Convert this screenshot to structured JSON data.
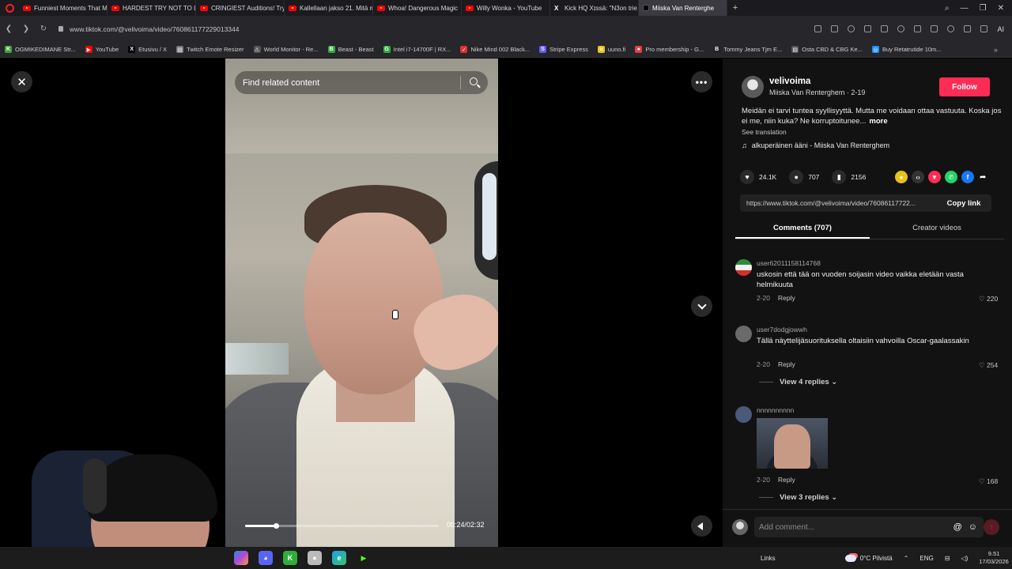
{
  "browser": {
    "tabs": [
      {
        "label": "Funniest Moments That M",
        "icon": "youtube-icon"
      },
      {
        "label": "HARDEST TRY NOT TO LAI",
        "icon": "youtube-icon"
      },
      {
        "label": "CRINGIEST Auditions! Try",
        "icon": "youtube-icon"
      },
      {
        "label": "Kallellaan jakso 21. Mitä m",
        "icon": "youtube-icon"
      },
      {
        "label": "Whoa! Dangerous Magic",
        "icon": "youtube-icon"
      },
      {
        "label": "Willy Wonka - YouTube",
        "icon": "youtube-icon"
      },
      {
        "label": "Kick HQ Xɪssä: \"N3on trie",
        "icon": "x-icon"
      },
      {
        "label": "Miiska Van Renterghe",
        "icon": "tiktok-icon",
        "active": true
      }
    ],
    "url": "www.tiktok.com/@velivoima/video/760861177229013344",
    "ai_label": "AI",
    "bookmarks": [
      {
        "label": "OGMIKEDIMANE Str...",
        "color": "#3fa535",
        "glyph": "K"
      },
      {
        "label": "YouTube",
        "color": "#ff0000",
        "glyph": "▶"
      },
      {
        "label": "Etusivu / X",
        "color": "#000000",
        "glyph": "X"
      },
      {
        "label": "Twitch Emote Resizer",
        "color": "#777777",
        "glyph": "▤"
      },
      {
        "label": "World Monitor - Re...",
        "color": "#555555",
        "glyph": "⚠"
      },
      {
        "label": "Beast - Beast",
        "color": "#2fae3a",
        "glyph": "B"
      },
      {
        "label": "Intel i7-14700F | RX...",
        "color": "#2fae3a",
        "glyph": "G"
      },
      {
        "label": "Nike Mind 002 Black...",
        "color": "#e03030",
        "glyph": "✓"
      },
      {
        "label": "Stripe Express",
        "color": "#635bff",
        "glyph": "S"
      },
      {
        "label": "uuno.fi",
        "color": "#e8c21c",
        "glyph": "u"
      },
      {
        "label": "Pro membership - G...",
        "color": "#e04040",
        "glyph": "●"
      },
      {
        "label": "Tommy Jeans Tjm E...",
        "color": "#222222",
        "glyph": "B"
      },
      {
        "label": "Osta CBD & CBG Ke...",
        "color": "#555555",
        "glyph": "▤"
      },
      {
        "label": "Buy Retatrutide 10m...",
        "color": "#1e90ff",
        "glyph": "◎"
      }
    ]
  },
  "player": {
    "search_placeholder": "Find related content",
    "timecode": "00:24/02:32",
    "progress": 0.16
  },
  "post": {
    "username": "velivoima",
    "nickname_date": "Miiska Van Renterghem · 2-19",
    "follow_label": "Follow",
    "description": "Meidän ei tarvi tuntea syyllisyyttä. Mutta me voidaan ottaa vastuuta. Koska jos ei me, niin kuka? Ne korruptoituneе...",
    "more_label": "more",
    "see_translation": "See translation",
    "sound": "alkuperäinen ääni - Miiska Van Renterghem",
    "likes": "24.1K",
    "comments": "707",
    "saves": "2156",
    "link": "https://www.tiktok.com/@velivoima/video/76086117722...",
    "copy_label": "Copy link",
    "tab_comments": "Comments (707)",
    "tab_creator": "Creator videos",
    "accent": "#fe2c55"
  },
  "comments": [
    {
      "user": "user62011158114768",
      "text": "uskosin että tää on vuoden soijasin video vaikka eletään vasta helmikuuta",
      "date": "2-20",
      "reply": "Reply",
      "likes": "220"
    },
    {
      "user": "user7dodgjowwh",
      "text": "Tällä näyttelijäsuorituksella oltaisiin vahvoilla Oscar-gaalassakin",
      "date": "2-20",
      "reply": "Reply",
      "likes": "254",
      "view_replies": "View 4 replies"
    },
    {
      "user": "nnnnnnnnnn",
      "text": "",
      "date": "2-20",
      "reply": "Reply",
      "likes": "168",
      "view_replies": "View 3 replies"
    }
  ],
  "composer": {
    "placeholder": "Add comment..."
  },
  "taskbar": {
    "links_label": "Links",
    "weather": "0°C  Pilvistä",
    "lang": "ENG",
    "time": "9.51",
    "date": "17/03/2026"
  }
}
